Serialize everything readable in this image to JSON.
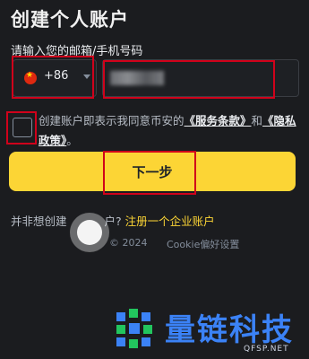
{
  "page": {
    "title": "创建个人账户",
    "phone_label": "请输入您的邮箱/手机号码"
  },
  "phone": {
    "country_code": "+86",
    "flag": "cn-flag-icon",
    "number_value": ""
  },
  "agreement": {
    "text_before": "创建账户即表示我同意币安的",
    "terms_link": "《服务条款》",
    "and": "和",
    "privacy_link": "《隐私政策》",
    "end": "。"
  },
  "buttons": {
    "next": "下一步"
  },
  "footer": {
    "corp_prefix": "并非想创建",
    "corp_mid": "户?",
    "corp_link": "注册一个企业账户",
    "copyright": "© 2024",
    "cookie": "Cookie偏好设置"
  },
  "watermark": {
    "brand": "量链科技",
    "url": "QFSP.NET",
    "color": "#3b82f6"
  },
  "colors": {
    "background": "#1b1c1f",
    "accent": "#fcd535",
    "highlight_box": "#d0021b"
  }
}
